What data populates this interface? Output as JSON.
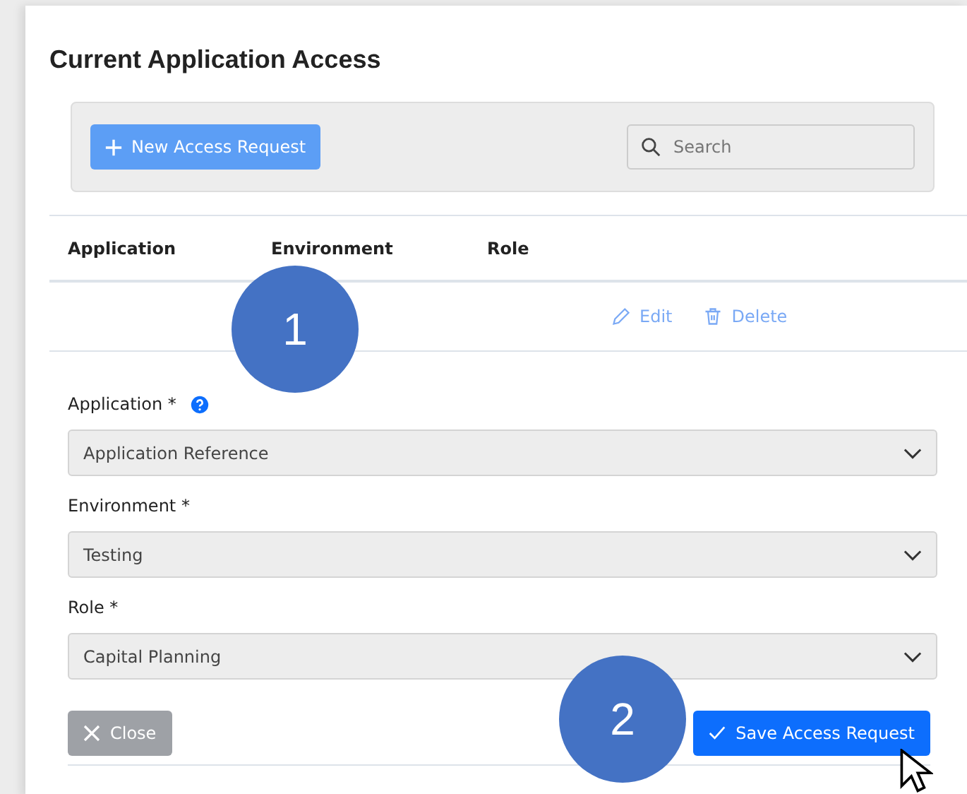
{
  "title": "Current Application Access",
  "toolbar": {
    "new_button": "New Access Request",
    "search": {
      "placeholder": "Search"
    }
  },
  "table": {
    "columns": [
      "Application",
      "Environment",
      "Role"
    ],
    "rows": [
      {
        "actions": [
          "Edit",
          "Delete"
        ]
      }
    ]
  },
  "form": {
    "fields": [
      {
        "label": "Application *",
        "help": true,
        "value": "Application Reference"
      },
      {
        "label": "Environment *",
        "help": false,
        "value": "Testing"
      },
      {
        "label": "Role *",
        "help": false,
        "value": "Capital Planning"
      }
    ]
  },
  "buttons": {
    "close": "Close",
    "save": "Save Access Request"
  },
  "callouts": [
    "1",
    "2"
  ]
}
